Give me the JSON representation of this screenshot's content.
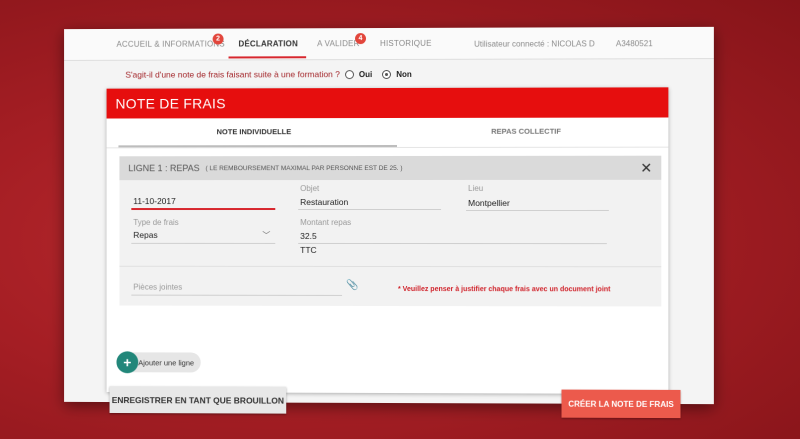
{
  "nav": {
    "items": [
      {
        "label": "ACCUEIL & INFORMATIONS",
        "badge": "2"
      },
      {
        "label": "DÉCLARATION",
        "active": true
      },
      {
        "label": "A VALIDER",
        "badge": "4"
      },
      {
        "label": "HISTORIQUE"
      }
    ],
    "user": "Utilisateur connecté : NICOLAS D",
    "user_id": "A3480521"
  },
  "question": {
    "text": "S'agit-il d'une note de frais faisant suite à une formation ?",
    "options": [
      "Oui",
      "Non"
    ],
    "selected": "Non"
  },
  "card": {
    "title": "NOTE DE FRAIS",
    "tabs": [
      "NOTE INDIVIDUELLE",
      "REPAS COLLECTIF"
    ],
    "active_tab": "NOTE INDIVIDUELLE",
    "ligne": {
      "title": "LIGNE 1 :  REPAS",
      "note": "( LE REMBOURSEMENT MAXIMAL PAR PERSONNE EST DE 25. )",
      "close": "✕",
      "date": "11-10-2017",
      "objet_label": "Objet",
      "objet_value": "Restauration",
      "lieu_label": "Lieu",
      "lieu_value": "Montpellier",
      "type_label": "Type de frais",
      "type_value": "Repas",
      "montant_label": "Montant repas",
      "montant_value": "32.5",
      "montant_suffix": "TTC",
      "pj_placeholder": "Pièces jointes",
      "warning": "* Veuillez penser à justifier chaque frais avec un document joint"
    },
    "add_line": "Ajouter une ligne",
    "draft_button": "ENREGISTRER EN TANT QUE BROUILLON",
    "create_button": "CRÉER LA NOTE DE FRAIS"
  },
  "colors": {
    "brand_red": "#e60e0e",
    "accent_button": "#ec5a4c",
    "add_button": "#22877a",
    "badge": "#e2463c"
  }
}
